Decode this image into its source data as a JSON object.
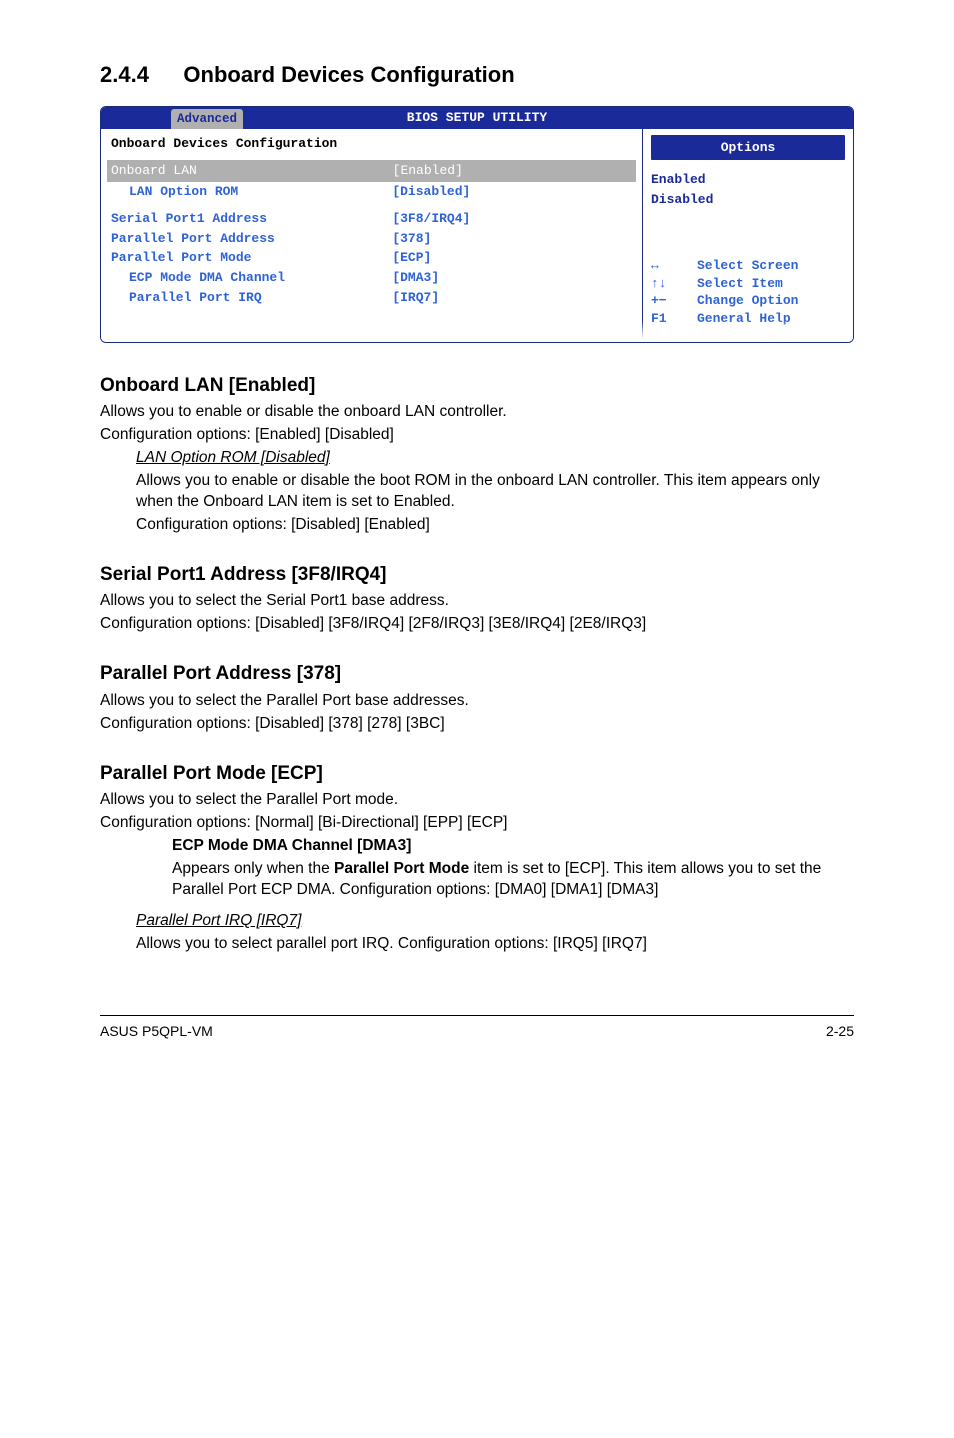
{
  "section": {
    "num": "2.4.4",
    "title": "Onboard Devices Configuration"
  },
  "bios": {
    "headerTitle": "BIOS SETUP UTILITY",
    "tab": "Advanced",
    "panelTitle": "Onboard Devices Configuration",
    "rows": {
      "onboardLan": {
        "k": "Onboard LAN",
        "v": "[Enabled]"
      },
      "lanOptionRom": {
        "k": "LAN Option ROM",
        "v": "[Disabled]"
      },
      "serialPort1Address": {
        "k": "Serial Port1 Address",
        "v": "[3F8/IRQ4]"
      },
      "parallelPortAddress": {
        "k": "Parallel Port Address",
        "v": "[378]"
      },
      "parallelPortMode": {
        "k": "Parallel Port Mode",
        "v": "[ECP]"
      },
      "ecpModeDmaChannel": {
        "k": "ECP Mode DMA Channel",
        "v": "[DMA3]"
      },
      "parallelPortIrq": {
        "k": "Parallel Port IRQ",
        "v": "[IRQ7]"
      }
    },
    "optionsTitle": "Options",
    "options": {
      "o1": "Enabled",
      "o2": "Disabled"
    },
    "nav": {
      "r1s": "↔",
      "r1t": "Select Screen",
      "r2s": "↑↓",
      "r2t": "Select Item",
      "r3s": "+−",
      "r3t": "Change Option",
      "r4s": "F1",
      "r4t": "General Help"
    }
  },
  "doc": {
    "h_onboardLan": "Onboard LAN [Enabled]",
    "p_onboardLan_1": "Allows you to enable or disable the onboard LAN controller.",
    "p_onboardLan_2": "Configuration options: [Enabled] [Disabled]",
    "h_lanOptRom": "LAN Option ROM [Disabled]",
    "p_lanOptRom_1": "Allows you to enable or disable the boot ROM in the onboard LAN controller. This item appears only when the Onboard LAN item is set to Enabled.",
    "p_lanOptRom_2": "Configuration options: [Disabled] [Enabled]",
    "h_serial": "Serial Port1 Address [3F8/IRQ4]",
    "p_serial_1": "Allows you to select the Serial Port1 base address.",
    "p_serial_2": "Configuration options: [Disabled] [3F8/IRQ4] [2F8/IRQ3] [3E8/IRQ4] [2E8/IRQ3]",
    "h_paraAddr": "Parallel Port Address [378]",
    "p_paraAddr_1": "Allows you to select the Parallel Port base addresses.",
    "p_paraAddr_2": "Configuration options: [Disabled] [378] [278] [3BC]",
    "h_paraMode": "Parallel Port Mode [ECP]",
    "p_paraMode_1": "Allows you to select the Parallel Port  mode.",
    "p_paraMode_2": "Configuration options: [Normal] [Bi-Directional] [EPP] [ECP]",
    "h_ecpDma": "ECP Mode DMA Channel [DMA3]",
    "p_ecpDma_1a": "Appears only when the ",
    "p_ecpDma_1b": "Parallel Port Mode",
    "p_ecpDma_1c": " item is set to [ECP]. This item allows you to set the Parallel Port ECP DMA. Configuration options: [DMA0] [DMA1] [DMA3]",
    "h_paraIrq": "Parallel Port IRQ [IRQ7]",
    "p_paraIrq_1": "Allows you to select parallel port IRQ. Configuration options: [IRQ5] [IRQ7]"
  },
  "footer": {
    "left": "ASUS P5QPL-VM",
    "right": "2-25"
  }
}
